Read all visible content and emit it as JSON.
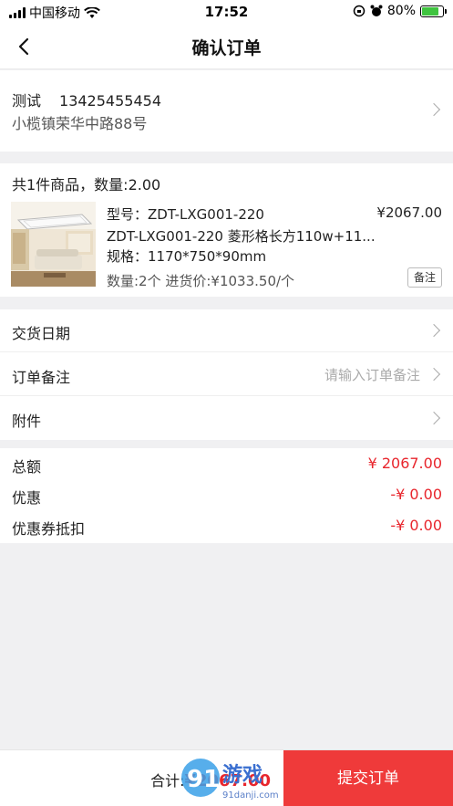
{
  "status_bar": {
    "carrier": "中国移动",
    "time": "17:52",
    "battery": "80%",
    "battery_level": 0.8
  },
  "nav": {
    "title": "确认订单"
  },
  "address": {
    "name": "测试",
    "phone": "13425455454",
    "detail": "小榄镇荣华中路88号"
  },
  "goods": {
    "summary": "共1件商品，数量:2.00",
    "item": {
      "model": "型号：ZDT-LXG001-220",
      "name": "ZDT-LXG001-220 菱形格长方110w+11...",
      "spec": "规格：1170*750*90mm",
      "qty_price": "数量:2个  进货价:¥1033.50/个",
      "price": "¥2067.00",
      "remark_label": "备注"
    }
  },
  "rows": {
    "delivery_date": "交货日期",
    "order_remark": "订单备注",
    "order_remark_placeholder": "请输入订单备注",
    "attachment": "附件"
  },
  "totals": {
    "total_label": "总额",
    "total_value": "¥ 2067.00",
    "discount_label": "优惠",
    "discount_value": "-¥ 0.00",
    "coupon_label": "优惠券抵扣",
    "coupon_value": "-¥ 0.00"
  },
  "bottom": {
    "sum_label": "合计:",
    "sum_value": "¥2067.00",
    "submit_label": "提交订单"
  },
  "watermark": {
    "brand": "游戏",
    "site": "91danji.com"
  },
  "colors": {
    "accent_red": "#e8262d",
    "submit_bg": "#ef3a3a"
  }
}
